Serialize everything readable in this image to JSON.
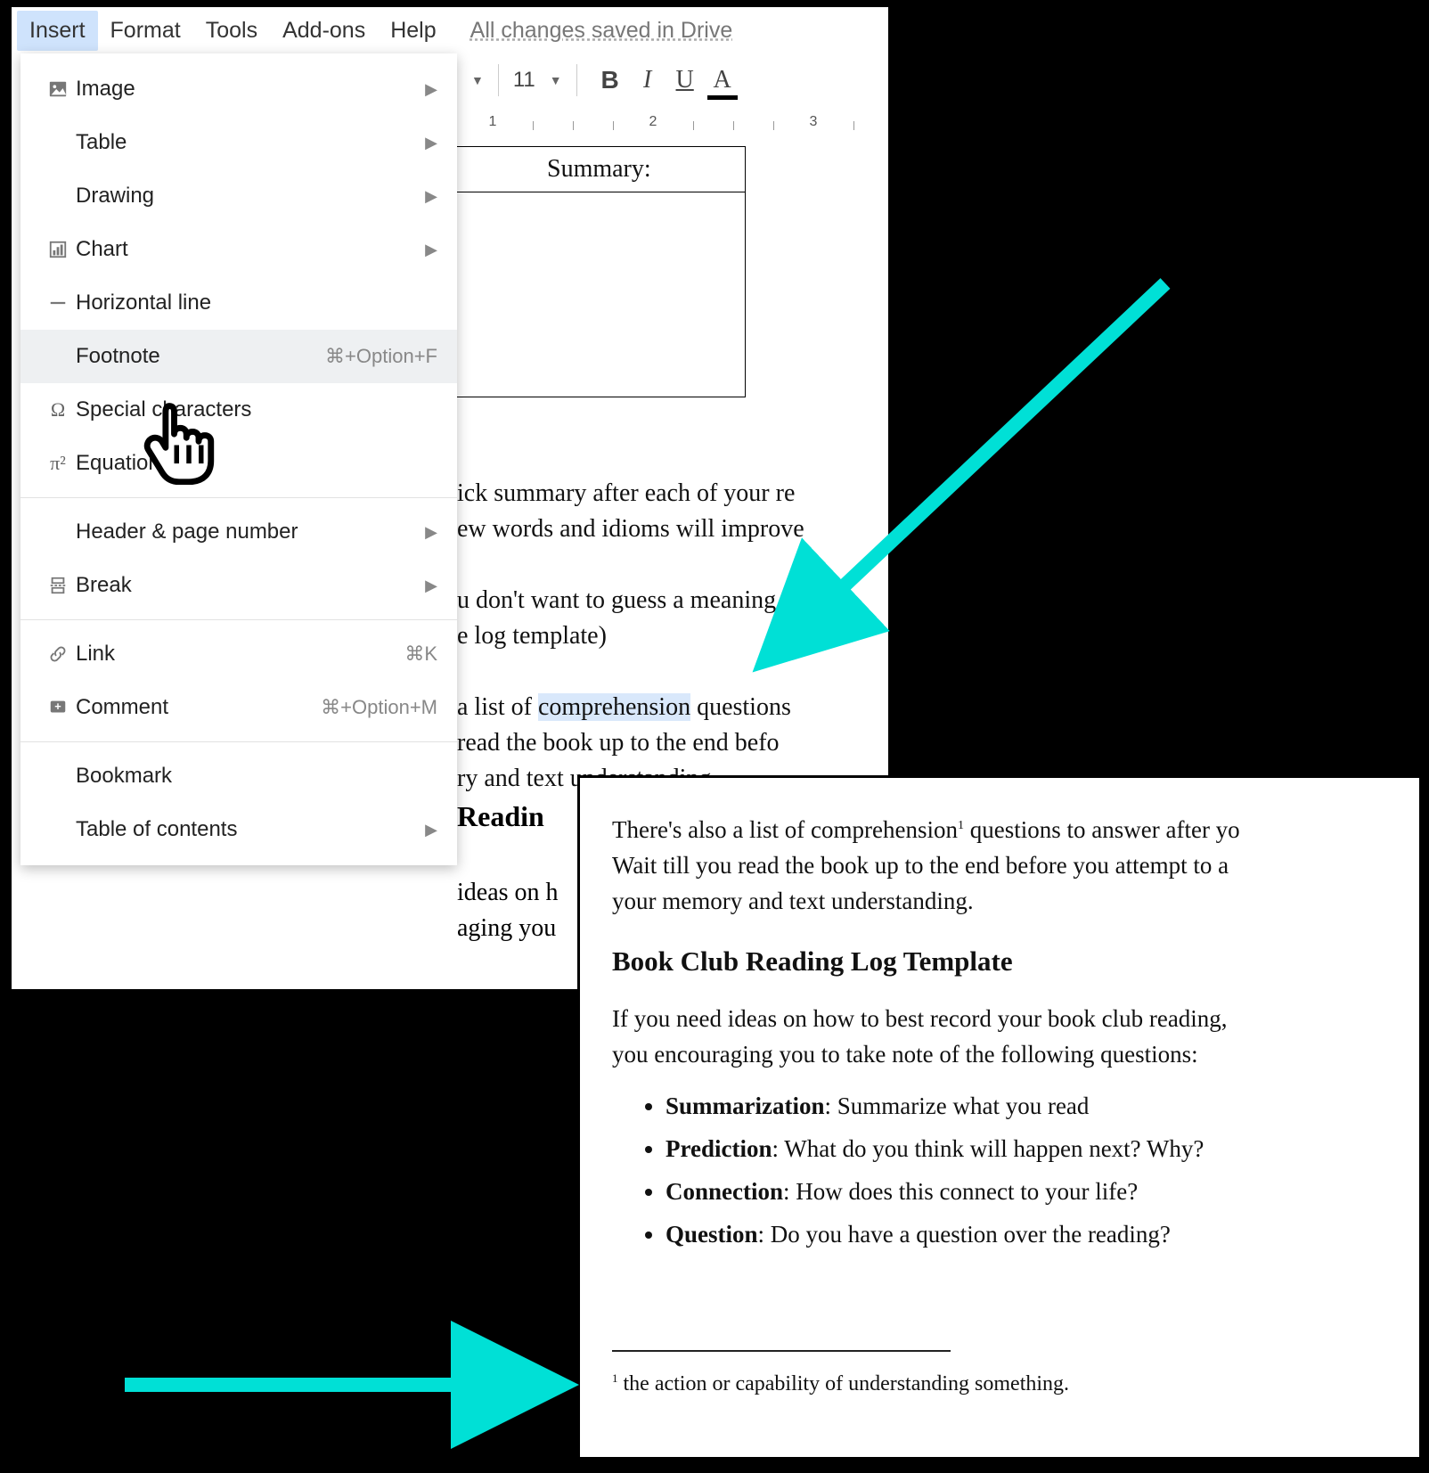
{
  "menubar": {
    "insert": "Insert",
    "format": "Format",
    "tools": "Tools",
    "addons": "Add-ons",
    "help": "Help",
    "status": "All changes saved in Drive"
  },
  "toolbar": {
    "font_size": "11",
    "bold": "B",
    "italic": "I",
    "underline": "U",
    "text_color": "A"
  },
  "ruler": {
    "marks": [
      "1",
      "2",
      "3"
    ]
  },
  "insert_menu": {
    "image": "Image",
    "table": "Table",
    "drawing": "Drawing",
    "chart": "Chart",
    "horizontal_line": "Horizontal line",
    "footnote": "Footnote",
    "footnote_shortcut": "⌘+Option+F",
    "special_chars": "Special characters",
    "equation": "Equation",
    "header_page": "Header & page number",
    "break": "Break",
    "link": "Link",
    "link_shortcut": "⌘K",
    "comment": "Comment",
    "comment_shortcut": "⌘+Option+M",
    "bookmark": "Bookmark",
    "toc": "Table of contents"
  },
  "doc": {
    "summary_label": "Summary:",
    "line1": "ick summary after each of your re",
    "line2": "ew words and idioms will improve",
    "line3a": "u don't want to guess a meaning",
    "line3b": "e log template)",
    "line4a_pre": " a list of ",
    "line4a_hl": "comprehension",
    "line4a_post": " questions",
    "line4b": " read the book up to the end befo",
    "line4c": "ry and text understanding.",
    "heading_partial": " Readin",
    "after1": "ideas on h",
    "after2": "aging you"
  },
  "preview": {
    "p1a": "There's also a list of comprehension",
    "p1sup": "1",
    "p1b": " questions to answer after yo",
    "p2": "Wait till you read the book up to the end before you attempt to a",
    "p3": "your memory and text understanding.",
    "heading": "Book Club Reading Log Template",
    "intro1": "If you need ideas on how to best record your book club reading, ",
    "intro2": "you encouraging you to take note of the following questions:",
    "li1_b": "Summarization",
    "li1_t": ": Summarize what you read",
    "li2_b": "Prediction",
    "li2_t": ": What do you think will happen next? Why?",
    "li3_b": "Connection",
    "li3_t": ": How does this connect to your life?",
    "li4_b": "Question",
    "li4_t": ": Do you have a question over the reading?",
    "footnote_num": "1",
    "footnote_text": " the action or capability of understanding something."
  },
  "colors": {
    "arrow": "#00E0D6"
  }
}
